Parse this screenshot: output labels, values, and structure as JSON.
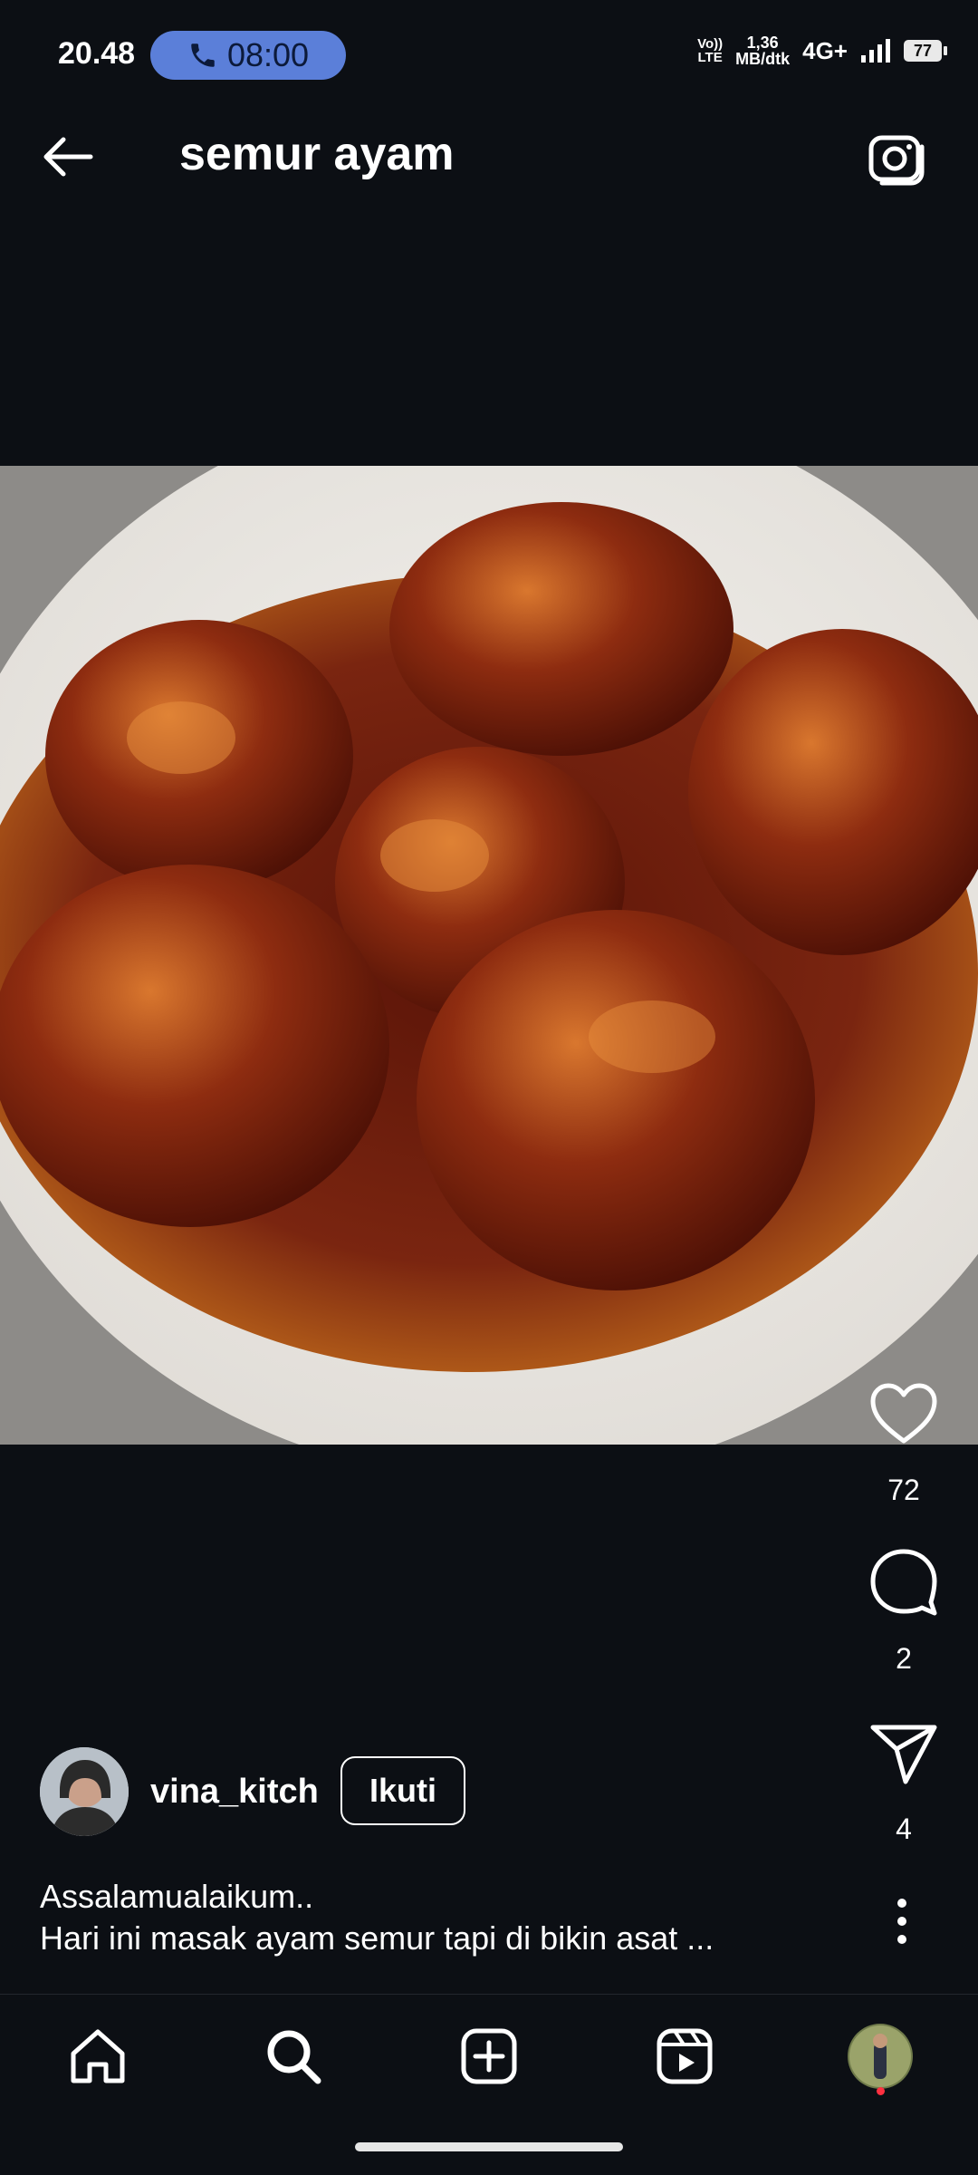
{
  "status_bar": {
    "time": "20.48",
    "call_timer": "08:00",
    "volte_line1": "Vo))",
    "volte_line2": "LTE",
    "speed_value": "1,36",
    "speed_unit": "MB/dtk",
    "network": "4G+",
    "battery": "77"
  },
  "header": {
    "title": "semur ayam"
  },
  "post": {
    "likes": "72",
    "comments": "2",
    "shares": "4",
    "username": "vina_kitch",
    "follow_label": "Ikuti",
    "caption_line1": "Assalamualaikum..",
    "caption_line2": "Hari ini masak ayam semur tapi di bikin asat ..."
  },
  "colors": {
    "background": "#0c0f14",
    "call_pill": "#5b7fd9",
    "notification_dot": "#ff3040"
  },
  "icons": [
    "back-arrow-icon",
    "camera-icon",
    "heart-icon",
    "comment-icon",
    "send-icon",
    "more-vertical-icon",
    "home-icon",
    "search-icon",
    "add-post-icon",
    "reels-icon",
    "profile-avatar"
  ]
}
